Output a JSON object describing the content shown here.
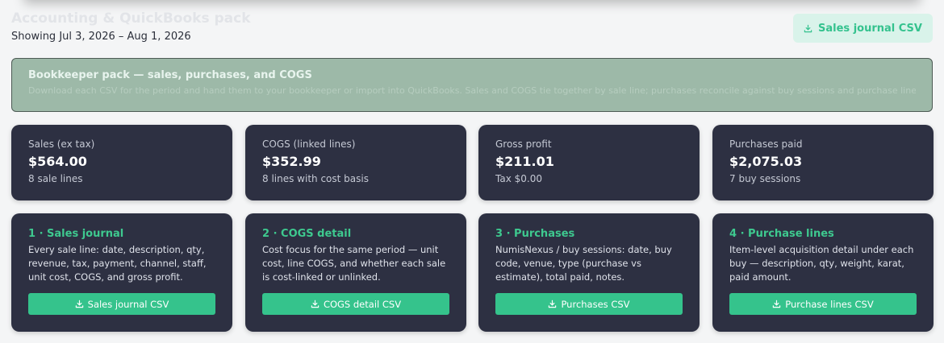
{
  "header": {
    "title": "Accounting & QuickBooks pack",
    "date_range": "Showing Jul 3, 2026 – Aug 1, 2026",
    "export_button": "Sales journal CSV"
  },
  "banner": {
    "title": "Bookkeeper pack — sales, purchases, and COGS",
    "description": "Download each CSV for the period and hand them to your bookkeeper or import into QuickBooks. Sales and COGS tie together by sale line; purchases reconcile against buy sessions and purchase lines."
  },
  "stats": [
    {
      "label": "Sales (ex tax)",
      "value": "$564.00",
      "sub": "8 sale lines"
    },
    {
      "label": "COGS (linked lines)",
      "value": "$352.99",
      "sub": "8 lines with cost basis"
    },
    {
      "label": "Gross profit",
      "value": "$211.01",
      "sub": "Tax $0.00"
    },
    {
      "label": "Purchases paid",
      "value": "$2,075.03",
      "sub": "7 buy sessions"
    }
  ],
  "exports": [
    {
      "title": "1 · Sales journal",
      "description": "Every sale line: date, description, qty, revenue, tax, payment, channel, staff, unit cost, COGS, and gross profit.",
      "button": "Sales journal CSV"
    },
    {
      "title": "2 · COGS detail",
      "description": "Cost focus for the same period — unit cost, line COGS, and whether each sale is cost-linked or unlinked.",
      "button": "COGS detail CSV"
    },
    {
      "title": "3 · Purchases",
      "description": "NumisNexus / buy sessions: date, buy code, venue, type (purchase vs estimate), total paid, notes.",
      "button": "Purchases CSV"
    },
    {
      "title": "4 · Purchase lines",
      "description": "Item-level acquisition detail under each buy — description, qty, weight, karat, paid amount.",
      "button": "Purchase lines CSV"
    }
  ],
  "icons": {
    "download": "download-icon"
  },
  "colors": {
    "accent_green": "#35c38c",
    "card_bg": "#2d3042",
    "banner_bg": "#9db9a8",
    "page_bg": "#f4f5f6"
  }
}
